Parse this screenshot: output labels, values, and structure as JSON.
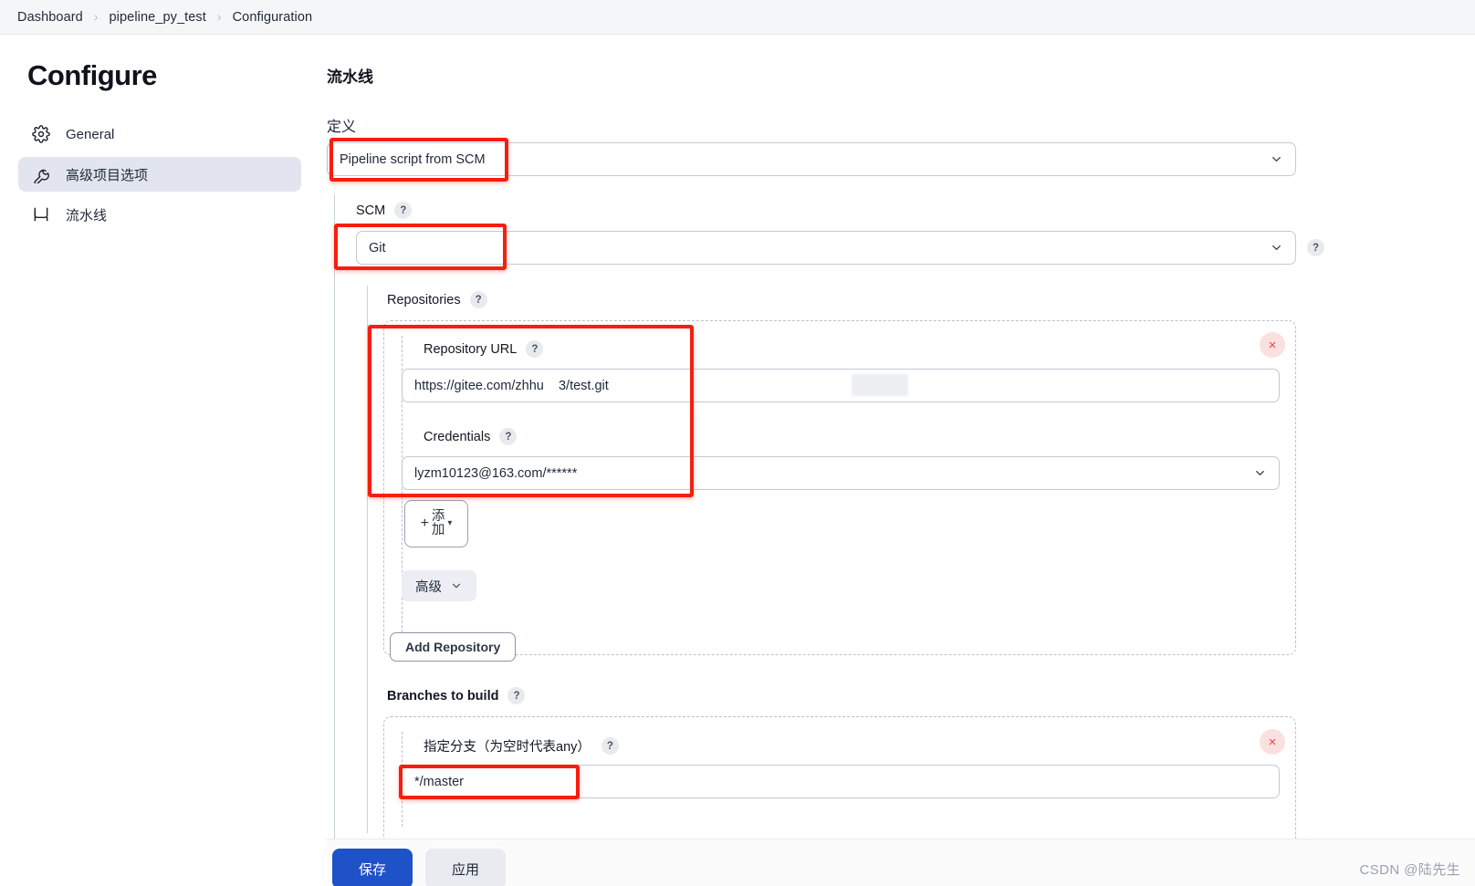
{
  "breadcrumb": {
    "items": [
      "Dashboard",
      "pipeline_py_test",
      "Configuration"
    ],
    "separator": "›"
  },
  "sidebar": {
    "title": "Configure",
    "items": [
      {
        "label": "General",
        "icon": "gear-icon",
        "active": false
      },
      {
        "label": "高级项目选项",
        "icon": "wrench-icon",
        "active": true
      },
      {
        "label": "流水线",
        "icon": "pipeline-icon",
        "active": false
      }
    ]
  },
  "main": {
    "section_title": "流水线",
    "definition": {
      "label": "定义",
      "value": "Pipeline script from SCM"
    },
    "scm": {
      "label": "SCM",
      "help": "?",
      "value": "Git",
      "side_help": "?"
    },
    "repositories": {
      "label": "Repositories",
      "help": "?",
      "repo": {
        "url_label": "Repository URL",
        "url_help": "?",
        "url_value": "https://gitee.com/zhhu  3/test.git",
        "credentials_label": "Credentials",
        "credentials_help": "?",
        "credentials_value": "lyzm10123@163.com/******",
        "delete_label": "×"
      },
      "add_button": {
        "plus": "+",
        "line1": "添",
        "line2": "加",
        "caret": "▾"
      },
      "advanced_button": {
        "label": "高级",
        "caret": "∨"
      },
      "add_repository_button": "Add Repository"
    },
    "branches": {
      "label": "Branches to build",
      "help": "?",
      "specifier_label": "指定分支（为空时代表any）",
      "specifier_help": "?",
      "specifier_value": "*/master",
      "delete_label": "×"
    }
  },
  "footer": {
    "save_label": "保存",
    "apply_label": "应用"
  },
  "watermark": "CSDN @陆先生",
  "colors": {
    "annotation_red": "#f61e0e",
    "primary_blue": "#1f52c8",
    "active_nav": "#e2e5ef",
    "delete_red": "#e5484d"
  }
}
